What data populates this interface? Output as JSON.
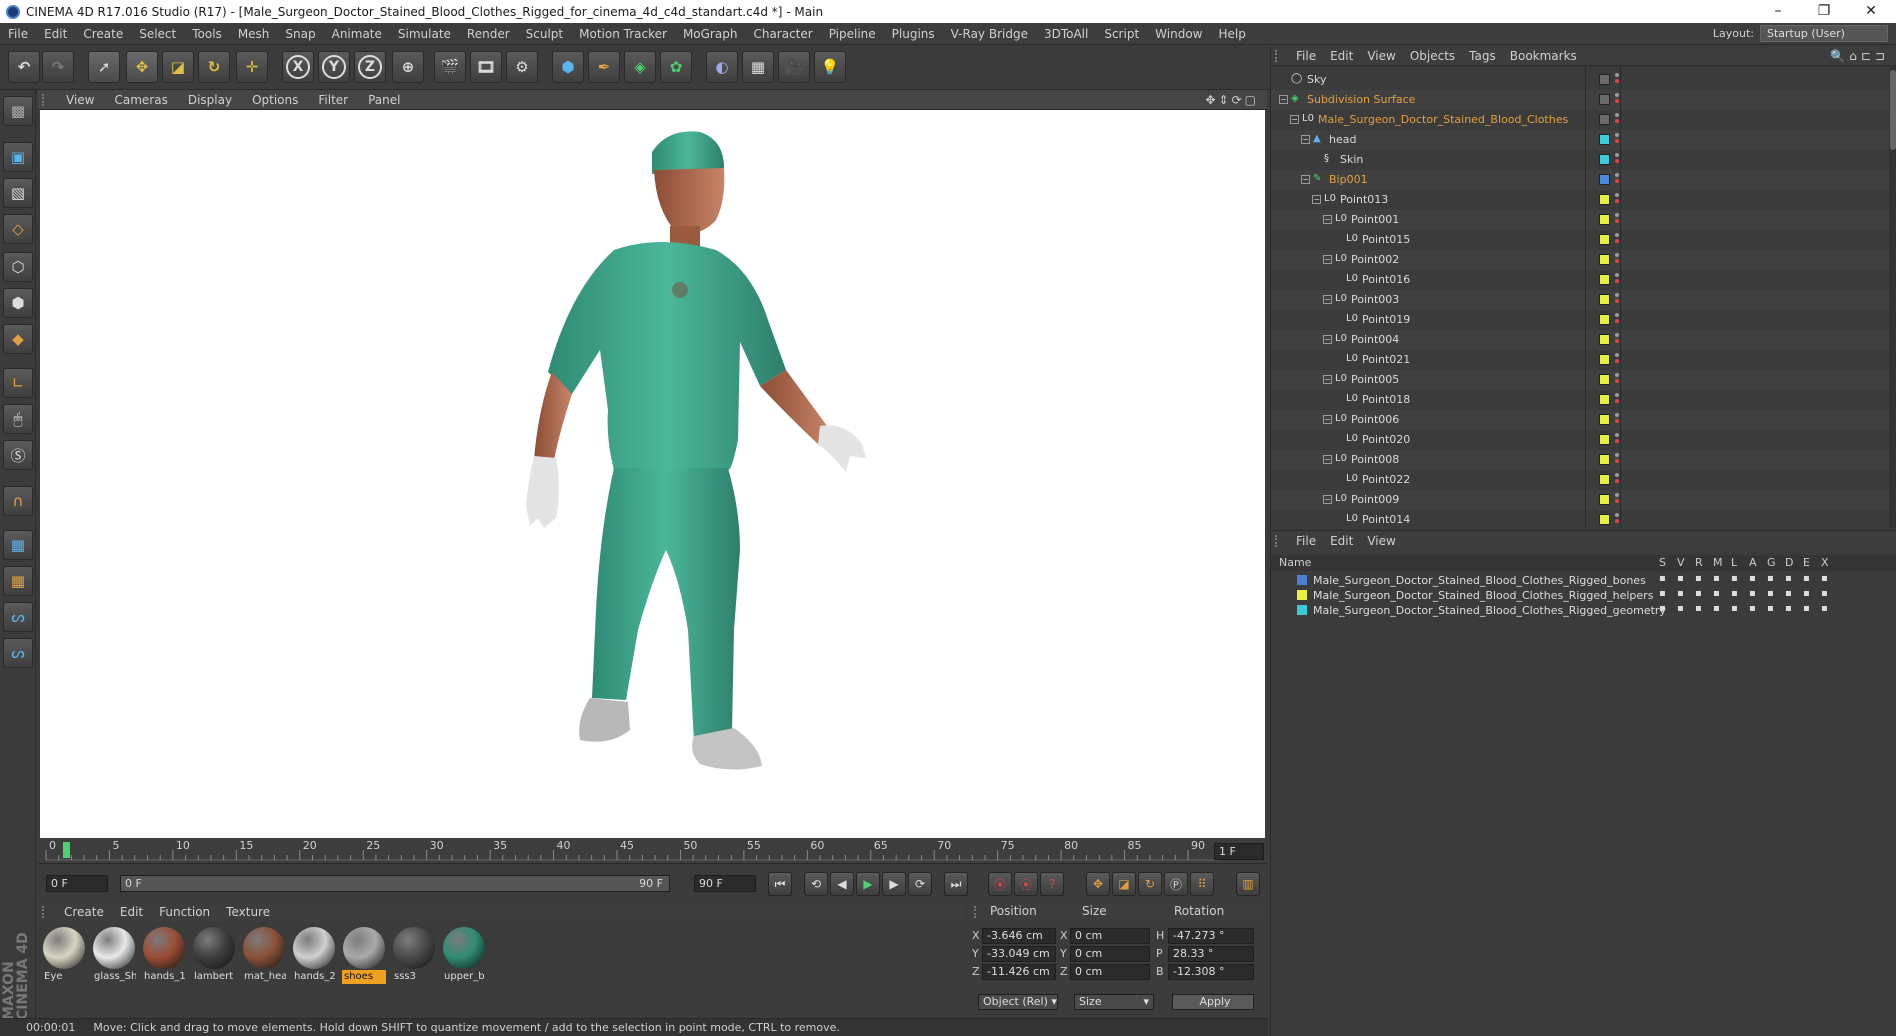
{
  "window": {
    "title": "CINEMA 4D R17.016 Studio (R17) - [Male_Surgeon_Doctor_Stained_Blood_Clothes_Rigged_for_cinema_4d_c4d_standart.c4d *] - Main",
    "controls": [
      "–",
      "❐",
      "✕"
    ]
  },
  "menubar": {
    "items": [
      "File",
      "Edit",
      "Create",
      "Select",
      "Tools",
      "Mesh",
      "Snap",
      "Animate",
      "Simulate",
      "Render",
      "Sculpt",
      "Motion Tracker",
      "MoGraph",
      "Character",
      "Pipeline",
      "Plugins",
      "V-Ray Bridge",
      "3DToAll",
      "Script",
      "Window",
      "Help"
    ],
    "layout_label": "Layout:",
    "layout_value": "Startup (User)"
  },
  "viewport": {
    "menu": [
      "View",
      "Cameras",
      "Display",
      "Options",
      "Filter",
      "Panel"
    ]
  },
  "timeline": {
    "ticks": [
      "0",
      "5",
      "10",
      "15",
      "20",
      "25",
      "30",
      "35",
      "40",
      "45",
      "50",
      "55",
      "60",
      "65",
      "70",
      "75",
      "80",
      "85",
      "90"
    ],
    "frame_field": "1 F",
    "current_frame": "0 F",
    "slider_start": "0 F",
    "slider_end": "90 F",
    "end_frame": "90 F"
  },
  "material_manager": {
    "menu": [
      "Create",
      "Edit",
      "Function",
      "Texture"
    ],
    "materials": [
      {
        "label": "Eye",
        "color": "#d9d4c4",
        "selected": false
      },
      {
        "label": "glass_Sh",
        "color": "#e8e8e8",
        "selected": false
      },
      {
        "label": "hands_1",
        "color": "#9a4d34",
        "selected": false
      },
      {
        "label": "lambert",
        "color": "#3e3e3e",
        "selected": false
      },
      {
        "label": "mat_hea",
        "color": "#8a5038",
        "selected": false
      },
      {
        "label": "hands_2",
        "color": "#cfcfcf",
        "selected": false
      },
      {
        "label": "shoes",
        "color": "#aaaaaa",
        "selected": true
      },
      {
        "label": "sss3",
        "color": "#4a4a4a",
        "selected": false
      },
      {
        "label": "upper_b",
        "color": "#2e8c76",
        "selected": false
      }
    ]
  },
  "coordinates": {
    "headers": [
      "Position",
      "Size",
      "Rotation"
    ],
    "rows": [
      {
        "axis": "X",
        "pos": "-3.646 cm",
        "size_axis": "X",
        "size": "0 cm",
        "rot_axis": "H",
        "rot": "-47.273 °"
      },
      {
        "axis": "Y",
        "pos": "-33.049 cm",
        "size_axis": "Y",
        "size": "0 cm",
        "rot_axis": "P",
        "rot": "28.33 °"
      },
      {
        "axis": "Z",
        "pos": "-11.426 cm",
        "size_axis": "Z",
        "size": "0 cm",
        "rot_axis": "B",
        "rot": "-12.308 °"
      }
    ],
    "mode": "Object (Rel)",
    "size_mode": "Size",
    "apply": "Apply"
  },
  "status": {
    "time": "00:00:01",
    "message": "Move: Click and drag to move elements. Hold down SHIFT to quantize movement / add to the selection in point mode, CTRL to remove."
  },
  "object_manager": {
    "menu": [
      "File",
      "Edit",
      "View",
      "Objects",
      "Tags",
      "Bookmarks"
    ],
    "rows": [
      {
        "name": "Sky",
        "indent": 0,
        "exp": "",
        "color": "#d8d8d8",
        "tag": "#6a6a6a",
        "icon": "sky-icon",
        "sym": "◯"
      },
      {
        "name": "Subdivision Surface",
        "indent": 0,
        "exp": "−",
        "color": "#e0a040",
        "tag": "#6a6a6a",
        "icon": "subdivision-icon",
        "sym": "◈"
      },
      {
        "name": "Male_Surgeon_Doctor_Stained_Blood_Clothes",
        "indent": 1,
        "exp": "−",
        "color": "#e0a040",
        "tag": "#6a6a6a",
        "icon": "null-icon",
        "sym": "L0"
      },
      {
        "name": "head",
        "indent": 2,
        "exp": "−",
        "color": "#d8d8d8",
        "tag": "#3ecbd8",
        "icon": "polygon-icon",
        "sym": "▲"
      },
      {
        "name": "Skin",
        "indent": 3,
        "exp": "",
        "color": "#d8d8d8",
        "tag": "#3ecbd8",
        "icon": "skin-icon",
        "sym": "§"
      },
      {
        "name": "Bip001",
        "indent": 2,
        "exp": "−",
        "color": "#e0a040",
        "tag": "#4a8ad8",
        "icon": "joint-icon",
        "sym": "✎"
      },
      {
        "name": "Point013",
        "indent": 3,
        "exp": "−",
        "color": "#d8d8d8",
        "tag": "#e6f040",
        "icon": "null-icon",
        "sym": "L0"
      },
      {
        "name": "Point001",
        "indent": 4,
        "exp": "−",
        "color": "#d8d8d8",
        "tag": "#e6f040",
        "icon": "null-icon",
        "sym": "L0"
      },
      {
        "name": "Point015",
        "indent": 5,
        "exp": "",
        "color": "#d8d8d8",
        "tag": "#e6f040",
        "icon": "null-icon",
        "sym": "L0"
      },
      {
        "name": "Point002",
        "indent": 4,
        "exp": "−",
        "color": "#d8d8d8",
        "tag": "#e6f040",
        "icon": "null-icon",
        "sym": "L0"
      },
      {
        "name": "Point016",
        "indent": 5,
        "exp": "",
        "color": "#d8d8d8",
        "tag": "#e6f040",
        "icon": "null-icon",
        "sym": "L0"
      },
      {
        "name": "Point003",
        "indent": 4,
        "exp": "−",
        "color": "#d8d8d8",
        "tag": "#e6f040",
        "icon": "null-icon",
        "sym": "L0"
      },
      {
        "name": "Point019",
        "indent": 5,
        "exp": "",
        "color": "#d8d8d8",
        "tag": "#e6f040",
        "icon": "null-icon",
        "sym": "L0"
      },
      {
        "name": "Point004",
        "indent": 4,
        "exp": "−",
        "color": "#d8d8d8",
        "tag": "#e6f040",
        "icon": "null-icon",
        "sym": "L0"
      },
      {
        "name": "Point021",
        "indent": 5,
        "exp": "",
        "color": "#d8d8d8",
        "tag": "#e6f040",
        "icon": "null-icon",
        "sym": "L0"
      },
      {
        "name": "Point005",
        "indent": 4,
        "exp": "−",
        "color": "#d8d8d8",
        "tag": "#e6f040",
        "icon": "null-icon",
        "sym": "L0"
      },
      {
        "name": "Point018",
        "indent": 5,
        "exp": "",
        "color": "#d8d8d8",
        "tag": "#e6f040",
        "icon": "null-icon",
        "sym": "L0"
      },
      {
        "name": "Point006",
        "indent": 4,
        "exp": "−",
        "color": "#d8d8d8",
        "tag": "#e6f040",
        "icon": "null-icon",
        "sym": "L0"
      },
      {
        "name": "Point020",
        "indent": 5,
        "exp": "",
        "color": "#d8d8d8",
        "tag": "#e6f040",
        "icon": "null-icon",
        "sym": "L0"
      },
      {
        "name": "Point008",
        "indent": 4,
        "exp": "−",
        "color": "#d8d8d8",
        "tag": "#e6f040",
        "icon": "null-icon",
        "sym": "L0"
      },
      {
        "name": "Point022",
        "indent": 5,
        "exp": "",
        "color": "#d8d8d8",
        "tag": "#e6f040",
        "icon": "null-icon",
        "sym": "L0"
      },
      {
        "name": "Point009",
        "indent": 4,
        "exp": "−",
        "color": "#d8d8d8",
        "tag": "#e6f040",
        "icon": "null-icon",
        "sym": "L0"
      },
      {
        "name": "Point014",
        "indent": 5,
        "exp": "",
        "color": "#d8d8d8",
        "tag": "#e6f040",
        "icon": "null-icon",
        "sym": "L0"
      }
    ]
  },
  "layer_manager": {
    "menu": [
      "File",
      "Edit",
      "View"
    ],
    "columns": [
      "Name",
      "S",
      "V",
      "R",
      "M",
      "L",
      "A",
      "G",
      "D",
      "E",
      "X"
    ],
    "layers": [
      {
        "name": "Male_Surgeon_Doctor_Stained_Blood_Clothes_Rigged_bones",
        "color": "#4a7fd1"
      },
      {
        "name": "Male_Surgeon_Doctor_Stained_Blood_Clothes_Rigged_helpers",
        "color": "#e6f040"
      },
      {
        "name": "Male_Surgeon_Doctor_Stained_Blood_Clothes_Rigged_geometry",
        "color": "#3ecbd8"
      }
    ]
  }
}
